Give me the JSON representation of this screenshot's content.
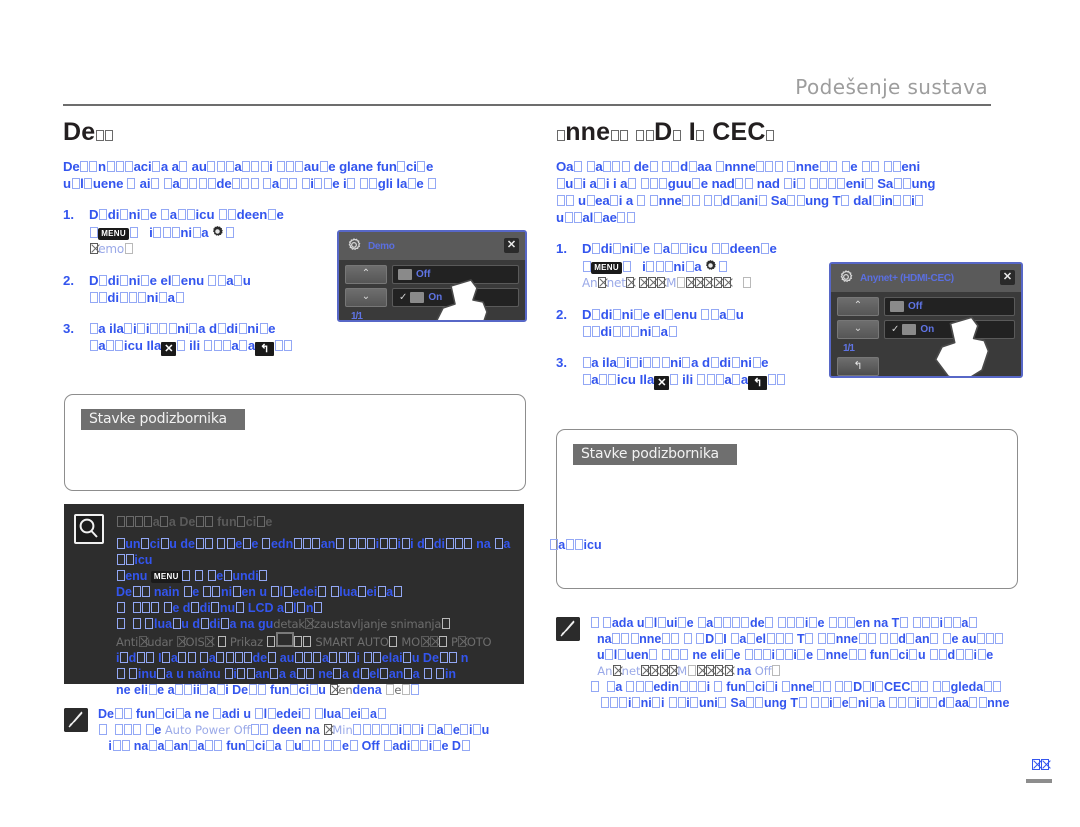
{
  "header": {
    "title": "Podešenje sustava"
  },
  "left_column": {
    "section_title": "Demo",
    "intro_lines": [
      "Demonstracija automatski prikazuje glavne funkcije",
      "uključene u vaš kamkorder kako biste ih mogli lakše koristiti."
    ],
    "steps": [
      {
        "num": "1.",
        "line1_before": "Dodirnite karticu izbornika ",
        "menu_icon": "MENU",
        "line1_mid": " → ",
        "line1_after": "postavki ",
        "gear_icon": "gear-icon",
        "sub": "Demo"
      },
      {
        "num": "2.",
        "line1": "Dodirnite željenu stavku",
        "line2": "podizbornika."
      },
      {
        "num": "3.",
        "line1": "Za izlaz iz izbornika dodirnite",
        "line2_before": "karticu Izlaz ",
        "close_icon": "✕",
        "line2_mid": " ili Natrag ",
        "back_icon": "↰"
      }
    ],
    "lcd": {
      "title": "Demo",
      "close_label": "✕",
      "up_label": "⌃",
      "down_label": "⌄",
      "option_off": "Off",
      "option_on": "On",
      "segment_label": "1/1",
      "back_label": "↰"
    },
    "submenu_label": "Stavke podizbornika",
    "infobox": {
      "icon": "magnifier-icon",
      "title": "Korištenje Demo funkcije",
      "lines": [
        "Funkciju demo možete pokrenuti samo ako ne koristite dodirnu karticu.",
        "izbornika."
      ],
      "menu_icon": "MENU",
      "line_after_menu": "→ Postavke → Demo",
      "line3": "Demo način se pokreće u sljedećim slučajevima:",
      "bullets": [
        "Ako se ne dodirne LCD zaslon.",
        "Ako se uključuje dodirna na gumb."
      ],
      "ghost_overlay": [
        "detalj zaustavljanje snimanja",
        "Anti-udar (OIS)   Prikaz   SMART AUTO   MODE   PHOTO"
      ],
      "tail_lines": [
        "i drugi. Kada kamkorder automatski ulazi u Demo način",
        "5 minuta u načinu mirovanja ako ne radi drugačije 5 minuta.",
        "Ako ne želite aktivirati Demo funkciju, postavite Demo na Off."
      ]
    },
    "note": {
      "icon": "pen-icon",
      "lines": [
        "Demo funkcija ne radi u sljedećim slučajevima:",
        "Ako je stavka Auto Power Off postavljena na 5 Min (kamkorder isključuje",
        "ako ne pritisnete nijednu funkciju u trajanju od 5 minuta) Off radit će se Demo."
      ],
      "inline_values": [
        "Auto Power Off",
        "5 Min",
        "Off"
      ]
    }
  },
  "right_column": {
    "section_title": "Anynet+ (HDMI-CEC)",
    "intro_lines": [
      "Ovaj kamkorder podržava standard Anynet+. Anynet+ je sustav izbornika",
      "koji upravlja i kontrolira AV uređaje pomoću naredbi nad svim povezanim",
      "Samsung uređajima s funkcijom Anynet+ povezanih Samsung TV-om dalje informacije",
      "upotrebljavajte."
    ],
    "steps": [
      {
        "num": "1.",
        "line1_before": "Dodirnite karticu izbornika ",
        "menu_icon": "MENU",
        "line1_mid": " → ",
        "line1_after": "postavki ",
        "gear_icon": "gear-icon",
        "sub": "Anynet+ (HDMI-CEC)"
      },
      {
        "num": "2.",
        "line1": "Dodirnite željenu stavku",
        "line2": "podizbornika."
      },
      {
        "num": "3.",
        "line1": "Za izlaz iz izbornika dodirnite",
        "line2_before": "karticu Izlaz ",
        "close_icon": "✕",
        "line2_mid": " ili Natrag ",
        "back_icon": "↰"
      }
    ],
    "lcd": {
      "title": "Anynet+ (HDMI-CEC)",
      "close_label": "✕",
      "up_label": "⌃",
      "down_label": "⌄",
      "option_off": "Off",
      "option_on": "On",
      "segment_label": "1/1",
      "back_label": "↰"
    },
    "submenu_label": "Stavke podizbornika",
    "note": {
      "icon": "pen-icon",
      "lines": [
        "Kada uključite kamkorder dok je povezan na TV pomoću kabela",
        "Anynet+ s HDMI kabelom, TV (s Anynet+ podržan) se automatski uključuje.",
        "Ako ne želite koristiti Anynet+ funkciju, postavite",
        "Anynet+ (HDMI-CEC) na Off.",
        "Za pojedinosti o funkciji Anynet+ (HDMI-CEC), pogledajte",
        "korisnički priručnik Samsung TV-a s tim značajkama i podržava Anynet+."
      ],
      "inline_values": [
        "Anynet+ (HDMI-CEC)",
        "Off"
      ]
    }
  },
  "page_number": "55",
  "colors": {
    "blue_body": "#3355ee",
    "heading_dark": "#231f20",
    "header_gray": "#9d9d9d",
    "infobox_bg": "#2d2d2d",
    "lcd_border": "#5767c7",
    "submenu_label_bg": "#6f6f6f"
  }
}
